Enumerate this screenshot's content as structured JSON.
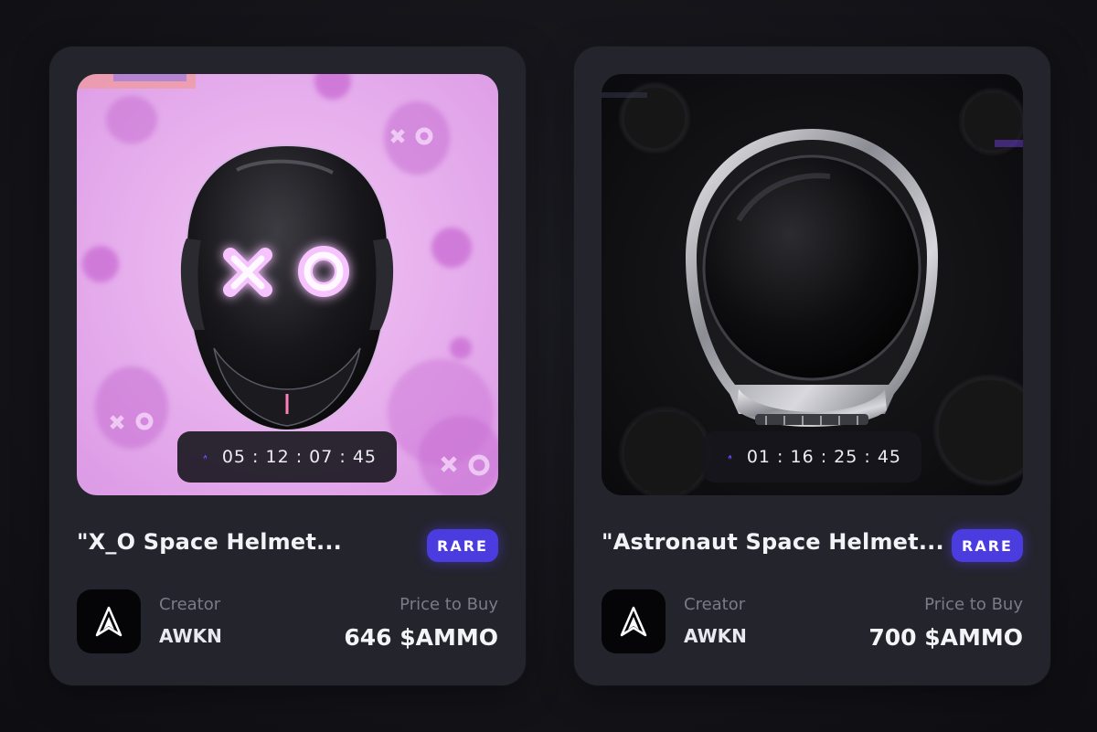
{
  "cards": [
    {
      "title": "\"X_O Space Helmet...",
      "rarity": "RARE",
      "timer": "05 : 12 : 07 : 45",
      "creator_label": "Creator",
      "creator_name": "AWKN",
      "price_label": "Price to Buy",
      "price_value": "646 $AMMO",
      "art_theme": "pink-background-black-helmet-xo-visor"
    },
    {
      "title": "\"Astronaut Space Helmet...",
      "rarity": "RARE",
      "timer": "01 : 16 : 25 : 45",
      "creator_label": "Creator",
      "creator_name": "AWKN",
      "price_label": "Price to Buy",
      "price_value": "700 $AMMO",
      "art_theme": "dark-background-chrome-astronaut-helmet"
    }
  ],
  "colors": {
    "card_background": "#24242d",
    "rarity_badge": "#4b3ce0",
    "flame_icon": "#6b4cff",
    "pink_art_background": "#e7a9ee"
  },
  "icons": {
    "timer_icon": "flame-icon",
    "creator_avatar": "awkn-logo-icon"
  }
}
